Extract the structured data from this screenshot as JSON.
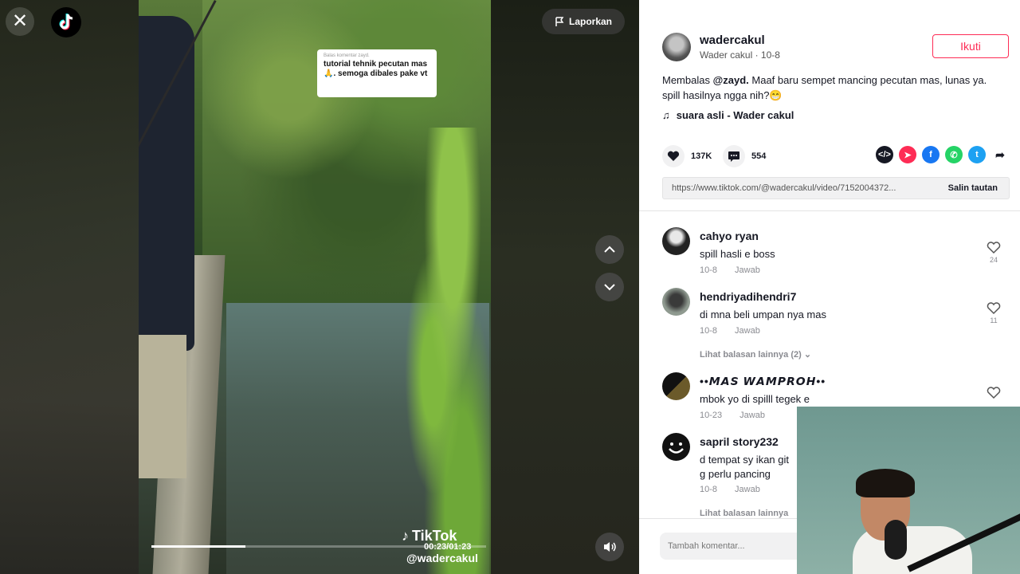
{
  "video": {
    "report_label": "Laporkan",
    "reply_card": {
      "small": "Balas komentar zayd.",
      "text": "tutorial tehnik pecutan mas🙏. semoga dibales pake vt"
    },
    "time": "00:23/01:23",
    "progress": 0.28,
    "watermark_brand": "TikTok",
    "watermark_handle": "@wadercakul"
  },
  "post": {
    "author_name": "wadercakul",
    "author_display": "Wader cakul",
    "date": "10-8",
    "author_sub": "Wader cakul · 10-8",
    "follow_label": "Ikuti",
    "caption_prefix": "Membalas ",
    "caption_mention": "@zayd.",
    "caption_text": " Maaf baru sempet mancing pecutan mas, lunas ya. spill hasilnya ngga nih?😁",
    "sound": "suara asli - Wader cakul",
    "likes": "137K",
    "comments": "554",
    "link_url": "https://www.tiktok.com/@wadercakul/video/7152004372...",
    "copy_label": "Salin tautan"
  },
  "comments": [
    {
      "name": "cahyo ryan",
      "text": "spill hasli e boss",
      "date": "10-8",
      "reply": "Jawab",
      "likes": "24"
    },
    {
      "name": "hendriyadihendri7",
      "text": "di mna beli umpan nya mas",
      "date": "10-8",
      "reply": "Jawab",
      "likes": "11"
    },
    {
      "name": "••𝙈𝘼𝙎 𝙒𝘼𝙈𝙋𝙍𝙊𝙃••",
      "text": "mbok yo di spilll tegek e",
      "date": "10-23",
      "reply": "Jawab",
      "likes": ""
    },
    {
      "name": "sapril story232",
      "text": "d tempat sy ikan git g perlu pancing",
      "date": "10-8",
      "reply": "Jawab",
      "likes": ""
    }
  ],
  "more_replies_1": "Lihat balasan lainnya (2)",
  "more_replies_2": "Lihat balasan lainnya",
  "comment_placeholder": "Tambah komentar...",
  "colors": {
    "accent": "#fe2c55",
    "panel_bg": "#ffffff",
    "muted": "#8a8b91"
  }
}
